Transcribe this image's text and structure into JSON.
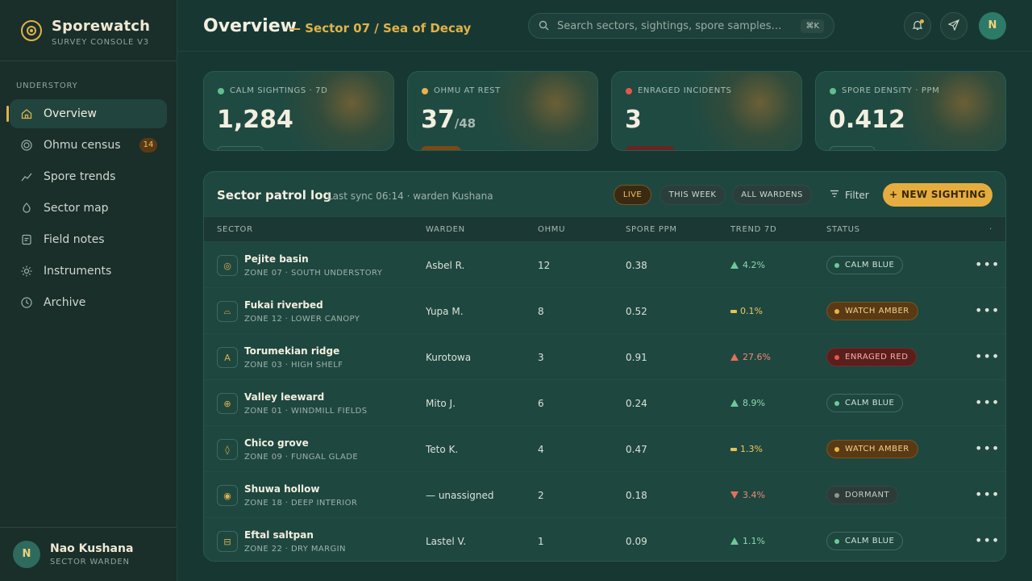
{
  "sidebar": {
    "brand_name": "Sporewatch",
    "brand_sub": "SURVEY CONSOLE V3",
    "section_label": "UNDERSTORY",
    "items": [
      {
        "label": "Overview",
        "icon": "home-icon"
      },
      {
        "label": "Ohmu census",
        "icon": "target-icon",
        "badge": "14"
      },
      {
        "label": "Spore trends",
        "icon": "trend-icon"
      },
      {
        "label": "Sector map",
        "icon": "map-pin-icon"
      },
      {
        "label": "Field notes",
        "icon": "notes-icon"
      },
      {
        "label": "Instruments",
        "icon": "gear-icon"
      },
      {
        "label": "Archive",
        "icon": "clock-icon"
      }
    ],
    "user": {
      "initial": "N",
      "name": "Nao Kushana",
      "role": "SECTOR WARDEN"
    }
  },
  "header": {
    "title": "Overview",
    "subtitle": "— Sector 07 / Sea of Decay",
    "search_placeholder": "Search sectors, sightings, spore samples…",
    "search_shortcut": "⌘K",
    "avatar_initial": "N"
  },
  "stats": [
    {
      "label": "CALM SIGHTINGS · 7D",
      "value": "1,284",
      "dot_color": "#5fbf8f"
    },
    {
      "label": "OHMU AT REST",
      "value": "37",
      "value_sub": "/48",
      "dot_color": "#e8b44a"
    },
    {
      "label": "ENRAGED INCIDENTS",
      "value": "3",
      "dot_color": "#e5574a"
    },
    {
      "label": "SPORE DENSITY · PPM",
      "value": "0.412",
      "dot_color": "#5fbf8f"
    }
  ],
  "log": {
    "title": "Sector patrol log",
    "sync": "Last sync 06:14 · warden Kushana",
    "chips": [
      "LIVE",
      "THIS WEEK",
      "ALL WARDENS"
    ],
    "filter_label": "Filter",
    "new_button": "+  NEW SIGHTING",
    "columns": [
      "SECTOR",
      "WARDEN",
      "OHMU",
      "SPORE PPM",
      "TREND 7D",
      "STATUS",
      "·"
    ],
    "rows": [
      {
        "glyph": "◎",
        "name": "Pejite basin",
        "zone": "ZONE 07 · SOUTH UNDERSTORY",
        "warden": "Asbel R.",
        "ohmu": "12",
        "ppm": "0.38",
        "trend": "4.2%",
        "trend_dir": "up",
        "status": "CALM BLUE",
        "status_kind": "blue"
      },
      {
        "glyph": "⌓",
        "name": "Fukai riverbed",
        "zone": "ZONE 12 · LOWER CANOPY",
        "warden": "Yupa M.",
        "ohmu": "8",
        "ppm": "0.52",
        "trend": "0.1%",
        "trend_dir": "flat",
        "status": "WATCH AMBER",
        "status_kind": "amber"
      },
      {
        "glyph": "A",
        "name": "Torumekian ridge",
        "zone": "ZONE 03 · HIGH SHELF",
        "warden": "Kurotowa",
        "ohmu": "3",
        "ppm": "0.91",
        "trend": "27.6%",
        "trend_dir": "up-red",
        "status": "ENRAGED RED",
        "status_kind": "red"
      },
      {
        "glyph": "⊕",
        "name": "Valley leeward",
        "zone": "ZONE 01 · WINDMILL FIELDS",
        "warden": "Mito J.",
        "ohmu": "6",
        "ppm": "0.24",
        "trend": "8.9%",
        "trend_dir": "up",
        "status": "CALM BLUE",
        "status_kind": "blue"
      },
      {
        "glyph": "◊",
        "name": "Chico grove",
        "zone": "ZONE 09 · FUNGAL GLADE",
        "warden": "Teto K.",
        "ohmu": "4",
        "ppm": "0.47",
        "trend": "1.3%",
        "trend_dir": "flat",
        "status": "WATCH AMBER",
        "status_kind": "amber"
      },
      {
        "glyph": "◉",
        "name": "Shuwa hollow",
        "zone": "ZONE 18 · DEEP INTERIOR",
        "warden": "— unassigned",
        "ohmu": "2",
        "ppm": "0.18",
        "trend": "3.4%",
        "trend_dir": "down",
        "status": "DORMANT",
        "status_kind": "dormant"
      },
      {
        "glyph": "⊟",
        "name": "Eftal saltpan",
        "zone": "ZONE 22 · DRY MARGIN",
        "warden": "Lastel V.",
        "ohmu": "1",
        "ppm": "0.09",
        "trend": "1.1%",
        "trend_dir": "up",
        "status": "CALM BLUE",
        "status_kind": "blue"
      }
    ]
  },
  "colors": {
    "accent": "#e0b24a",
    "calm": "#6dc99a",
    "enraged": "#e5574a",
    "background": "#173832"
  }
}
